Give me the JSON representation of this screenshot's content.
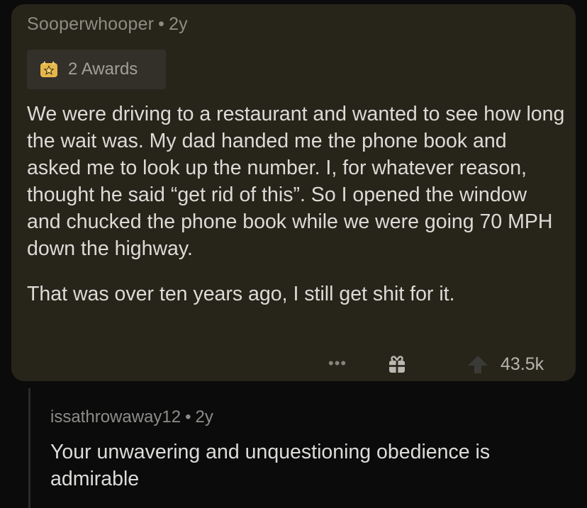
{
  "comment": {
    "author": "Sooperwhooper",
    "separator": "•",
    "age": "2y",
    "awards_label": "2 Awards",
    "paragraphs": [
      "We were driving to a restaurant and wanted to see how long the wait was. My dad handed me the phone book and asked me to look up the number. I, for whatever reason, thought he said “get rid of this”. So I opened the window and chucked the phone book while we were going 70 MPH down the highway.",
      "That was over ten years ago, I still get shit for it."
    ],
    "more_label": "•••",
    "score": "43.5k",
    "icons": {
      "award": "award-star-icon",
      "gift": "gift-icon",
      "upvote": "upvote-arrow-icon",
      "more": "more-options-icon"
    }
  },
  "reply": {
    "author": "issathrowaway12",
    "separator": "•",
    "age": "2y",
    "text": "Your unwavering and unquestioning obedience is admirable"
  },
  "colors": {
    "background": "#0b0b0b",
    "card": "#27241a",
    "award_badge": "#33302a",
    "award_gold": "#e7b64a",
    "text": "#dcdbd6",
    "muted": "#8f8c83"
  }
}
